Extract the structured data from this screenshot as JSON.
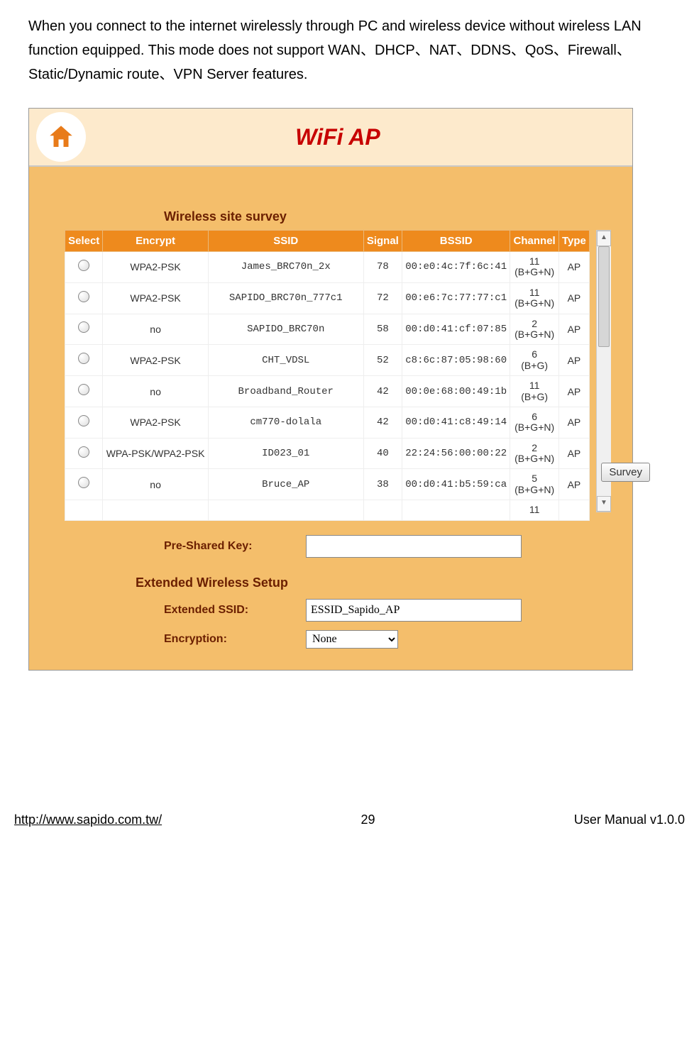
{
  "intro": "When you connect to the internet wirelessly through PC and wireless device without wireless LAN function equipped. This mode does not support WAN、DHCP、NAT、DDNS、QoS、Firewall、Static/Dynamic route、VPN Server features.",
  "title": "WiFi AP",
  "survey_title": "Wireless site survey",
  "columns": {
    "select": "Select",
    "encrypt": "Encrypt",
    "ssid": "SSID",
    "signal": "Signal",
    "bssid": "BSSID",
    "channel": "Channel",
    "type": "Type"
  },
  "rows": [
    {
      "encrypt": "WPA2-PSK",
      "ssid": "James_BRC70n_2x",
      "signal": "78",
      "bssid": "00:e0:4c:7f:6c:41",
      "channel": "11 (B+G+N)",
      "type": "AP"
    },
    {
      "encrypt": "WPA2-PSK",
      "ssid": "SAPIDO_BRC70n_777c1",
      "signal": "72",
      "bssid": "00:e6:7c:77:77:c1",
      "channel": "11 (B+G+N)",
      "type": "AP"
    },
    {
      "encrypt": "no",
      "ssid": "SAPIDO_BRC70n",
      "signal": "58",
      "bssid": "00:d0:41:cf:07:85",
      "channel": "2 (B+G+N)",
      "type": "AP"
    },
    {
      "encrypt": "WPA2-PSK",
      "ssid": "CHT_VDSL",
      "signal": "52",
      "bssid": "c8:6c:87:05:98:60",
      "channel": "6 (B+G)",
      "type": "AP"
    },
    {
      "encrypt": "no",
      "ssid": "Broadband_Router",
      "signal": "42",
      "bssid": "00:0e:68:00:49:1b",
      "channel": "11 (B+G)",
      "type": "AP"
    },
    {
      "encrypt": "WPA2-PSK",
      "ssid": "cm770-dolala",
      "signal": "42",
      "bssid": "00:d0:41:c8:49:14",
      "channel": "6 (B+G+N)",
      "type": "AP"
    },
    {
      "encrypt": "WPA-PSK/WPA2-PSK",
      "ssid": "ID023_01",
      "signal": "40",
      "bssid": "22:24:56:00:00:22",
      "channel": "2 (B+G+N)",
      "type": "AP"
    },
    {
      "encrypt": "no",
      "ssid": "Bruce_AP",
      "signal": "38",
      "bssid": "00:d0:41:b5:59:ca",
      "channel": "5 (B+G+N)",
      "type": "AP"
    }
  ],
  "cut_row_channel": "11",
  "survey_button": "Survey",
  "psk_label": "Pre-Shared Key:",
  "psk_value": "",
  "ext_title": "Extended Wireless Setup",
  "ext_ssid_label": "Extended SSID:",
  "ext_ssid_value": "ESSID_Sapido_AP",
  "encryption_label": "Encryption:",
  "encryption_value": "None",
  "footer": {
    "url": "http://www.sapido.com.tw/",
    "page": "29",
    "right": "User Manual v1.0.0"
  }
}
